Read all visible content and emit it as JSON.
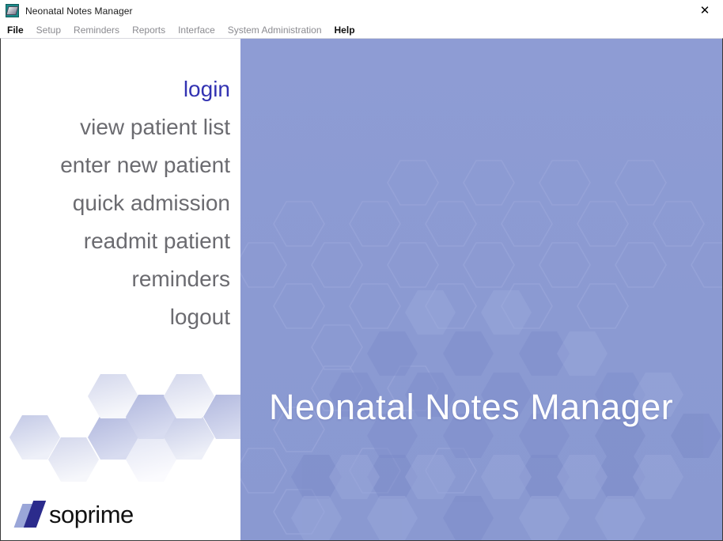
{
  "window": {
    "title": "Neonatal Notes Manager",
    "icon": "app-icon",
    "close_label": "✕"
  },
  "menubar": {
    "items": [
      {
        "label": "File",
        "emphasis": true
      },
      {
        "label": "Setup",
        "emphasis": false
      },
      {
        "label": "Reminders",
        "emphasis": false
      },
      {
        "label": "Reports",
        "emphasis": false
      },
      {
        "label": "Interface",
        "emphasis": false
      },
      {
        "label": "System Administration",
        "emphasis": false
      },
      {
        "label": "Help",
        "emphasis": true
      }
    ]
  },
  "nav": {
    "items": [
      {
        "label": "login",
        "active": true
      },
      {
        "label": "view patient list",
        "active": false
      },
      {
        "label": "enter new patient",
        "active": false
      },
      {
        "label": "quick admission",
        "active": false
      },
      {
        "label": "readmit patient",
        "active": false
      },
      {
        "label": "reminders",
        "active": false
      },
      {
        "label": "logout",
        "active": false
      }
    ]
  },
  "splash": {
    "title": "Neonatal Notes Manager"
  },
  "logo": {
    "text": "soprime",
    "mark": "isoprime-logo-mark"
  },
  "colors": {
    "panel_blue": "#8b9ad2",
    "active_link": "#3333b2",
    "nav_link": "#6b6b70",
    "title_white": "#ffffff",
    "logo_dark": "#2b2b8c",
    "logo_light": "#9aa6d8",
    "hex_light": "#d6daee"
  }
}
